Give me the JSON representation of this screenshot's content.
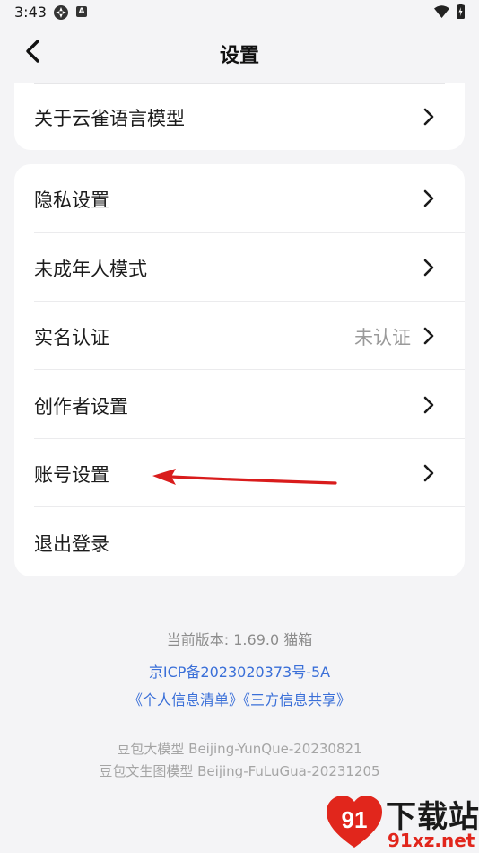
{
  "status_bar": {
    "time": "3:43",
    "notif_badge": "A"
  },
  "header": {
    "title": "设置"
  },
  "card_top": {
    "items": [
      {
        "label": "关于云雀语言模型"
      }
    ]
  },
  "card_main": {
    "items": [
      {
        "label": "隐私设置"
      },
      {
        "label": "未成年人模式"
      },
      {
        "label": "实名认证",
        "value": "未认证"
      },
      {
        "label": "创作者设置"
      },
      {
        "label": "账号设置"
      },
      {
        "label": "退出登录"
      }
    ]
  },
  "footer": {
    "version": "当前版本: 1.69.0 猫箱",
    "icp": "京ICP备2023020373号-5A",
    "policies": "《个人信息清单》《三方信息共享》",
    "model_1": "豆包大模型 Beijing-YunQue-20230821",
    "model_2": "豆包文生图模型 Beijing-FuLuGua-20231205"
  },
  "watermark": {
    "brand": "下载站",
    "url": "91xz.net"
  },
  "colors": {
    "link": "#3a6fd8",
    "annotation": "#d91c1c",
    "background": "#f4f4f6"
  }
}
